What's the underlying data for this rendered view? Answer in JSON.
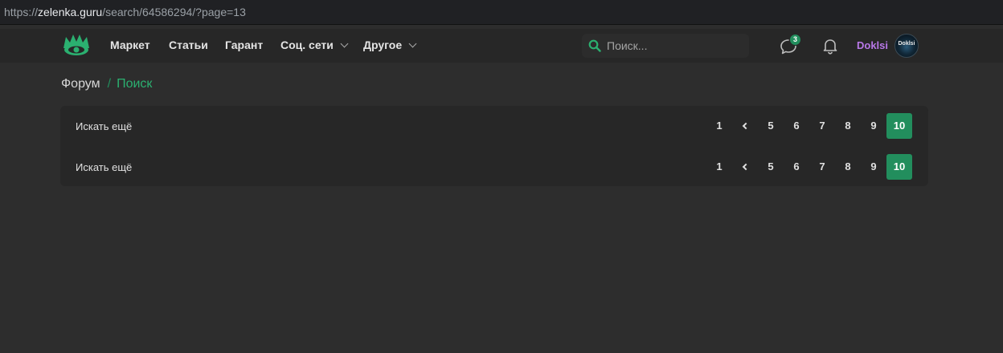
{
  "browser": {
    "url_prefix": "https://",
    "url_host": "zelenka.guru",
    "url_path": "/search/64586294/?page=13"
  },
  "navbar": {
    "items": [
      {
        "label": "Маркет"
      },
      {
        "label": "Статьи"
      },
      {
        "label": "Гарант"
      },
      {
        "label": "Соц. сети"
      },
      {
        "label": "Другое"
      }
    ],
    "search_placeholder": "Поиск...",
    "messages_badge": "3",
    "username": "Doklsi",
    "avatar_text": "Doklsi"
  },
  "breadcrumb": {
    "forum": "Форум",
    "separator": "/",
    "current": "Поиск"
  },
  "results": {
    "rows": [
      {
        "search_more": "Искать ещё",
        "pages": [
          {
            "label": "1",
            "active": false
          },
          {
            "label": "",
            "icon": "chevron-left-icon",
            "active": false
          },
          {
            "label": "5",
            "active": false
          },
          {
            "label": "6",
            "active": false
          },
          {
            "label": "7",
            "active": false
          },
          {
            "label": "8",
            "active": false
          },
          {
            "label": "9",
            "active": false
          },
          {
            "label": "10",
            "active": true
          }
        ]
      },
      {
        "search_more": "Искать ещё",
        "pages": [
          {
            "label": "1",
            "active": false
          },
          {
            "label": "",
            "icon": "chevron-left-icon",
            "active": false
          },
          {
            "label": "5",
            "active": false
          },
          {
            "label": "6",
            "active": false
          },
          {
            "label": "7",
            "active": false
          },
          {
            "label": "8",
            "active": false
          },
          {
            "label": "9",
            "active": false
          },
          {
            "label": "10",
            "active": true
          }
        ]
      }
    ]
  },
  "colors": {
    "accent": "#228e5d",
    "accent_text": "#2bb070",
    "username": "#b878e8",
    "background": "#2d2d2d",
    "panel": "#272727"
  }
}
